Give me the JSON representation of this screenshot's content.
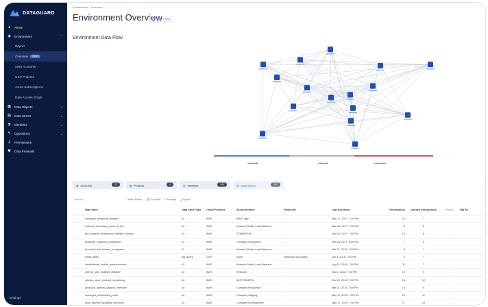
{
  "brand": {
    "name": "DATAGUARD"
  },
  "sidebar": {
    "items": [
      {
        "label": "Alerts",
        "icon": "bell-icon",
        "glyph": "●"
      },
      {
        "label": "Environment",
        "icon": "globe-icon",
        "glyph": "◉"
      },
      {
        "label": "Report",
        "sub": true
      },
      {
        "label": "Overview",
        "sub": true,
        "active": true,
        "badge": "NEW"
      },
      {
        "label": "AWS Accounts",
        "sub": true
      },
      {
        "label": "GCP Projects",
        "sub": true
      },
      {
        "label": "Azure Subscriptions",
        "sub": true
      },
      {
        "label": "Data Access Graph",
        "sub": true
      },
      {
        "label": "Data Objects",
        "icon": "grid-icon",
        "glyph": "▦"
      },
      {
        "label": "Data Stores",
        "icon": "database-icon",
        "glyph": "▤"
      },
      {
        "label": "Identities",
        "icon": "user-icon",
        "glyph": "◍"
      },
      {
        "label": "Operations",
        "icon": "wrench-icon",
        "glyph": "✎"
      },
      {
        "label": "Permissions",
        "icon": "key-icon",
        "glyph": "⚷"
      },
      {
        "label": "Data Firewalls",
        "icon": "shield-icon",
        "glyph": "⛊"
      }
    ],
    "settings": "Settings"
  },
  "header": {
    "breadcrumb": "Environment  >  Overview",
    "title": "Environment Overview",
    "page_filters": "▾ Page Filters"
  },
  "flow": {
    "title": "Environment Data Flow",
    "legend": [
      "external",
      "internal",
      "unknown"
    ],
    "legend_colors": [
      "#4a7fd9",
      "#9db6e6",
      "#e0524f"
    ],
    "node_color": "#1f4fb8"
  },
  "tabs": [
    {
      "label": "Accounts",
      "count": "12"
    },
    {
      "label": "Projects",
      "count": "4"
    },
    {
      "label": "Identities",
      "count": "140"
    },
    {
      "label": "Data Stores",
      "count": "260",
      "active": true
    }
  ],
  "toolbar": {
    "search": "Search...",
    "table_filters": "Table Filters",
    "columns": "Columns",
    "density": "Density",
    "export": "Export"
  },
  "popup": [
    "Mo",
    "Mo",
    "Mo"
  ],
  "table": {
    "columns": [
      "Data Store",
      "Data Store Type",
      "Cloud Provider",
      "Account Name",
      "Project ID",
      "Last Accessed",
      "Permissions",
      "Unused Permissions",
      "Public",
      "Hid Re"
    ],
    "rows": [
      [
        "managed_analyzing_adapter",
        "s3",
        "AWS",
        "Alert Logic",
        "-",
        "May 17, 2017, 7:00 PM",
        "13",
        "7",
        "-"
      ],
      [
        "reduced_secondary_secured_line",
        "s3",
        "AWS",
        "Amazon Elastic Load Balancer",
        "-",
        "May 28, 2017, 7:00 PM",
        "8",
        "8",
        "-"
      ],
      [
        "pre_emptive_foreground_internet_solution",
        "s3",
        "AWS",
        "D796490758",
        "-",
        "Nov 18, 2017, 7:00 PM",
        "10",
        "8",
        "-"
      ],
      [
        "proactive_systemic_parallelism",
        "s3",
        "AWS",
        "Company Production",
        "-",
        "Nov 23, 2017, 8:00 PM",
        "7",
        "8",
        "-"
      ],
      [
        "focused_fault_tolerant_encryption",
        "s3",
        "AWS",
        "Amazon Elastic Load Balancer",
        "-",
        "Mar 21, 2018, 7:00 PM",
        "8",
        "7",
        "-"
      ],
      [
        "Parks-Miller",
        "big_query",
        "GCP",
        "None",
        "protection-dk-project",
        "Jun 3, 2018, 7:00 PM",
        "9",
        "7",
        "-"
      ],
      [
        "fundamental_radical_superstructure",
        "s3",
        "AWS",
        "Amazon Elastic Load Balancer",
        "-",
        "Aug 21, 2018, 7:00 PM",
        "11",
        "7",
        "✓"
      ],
      [
        "diverse_grid_enabled_initiative",
        "s3",
        "AWS",
        "RedLock",
        "-",
        "Nov 2, 2018, 7:00 PM",
        "10",
        "9",
        "-"
      ],
      [
        "intuitive_user_enabled_monitoring",
        "s3",
        "AWS",
        "467772508734",
        "-",
        "Dec 22, 2018, 7:00 PM",
        "18",
        "12",
        "-"
      ],
      [
        "profound_optimal_graphic_interface",
        "s3",
        "AWS",
        "Company Production",
        "-",
        "Mar 21, 2019, 7:00 PM",
        "10",
        "9",
        "-"
      ],
      [
        "managed_multimedia_portal",
        "s3",
        "AWS",
        "Company Staging",
        "-",
        "May 11, 2019, 7:00 PM",
        "13",
        "11",
        "-"
      ],
      [
        "multi_layered_actuating_structure",
        "s3",
        "AWS",
        "Company Development",
        "-",
        "May 17, 2019, 7:00 PM",
        "17",
        "10",
        "✓"
      ]
    ]
  }
}
